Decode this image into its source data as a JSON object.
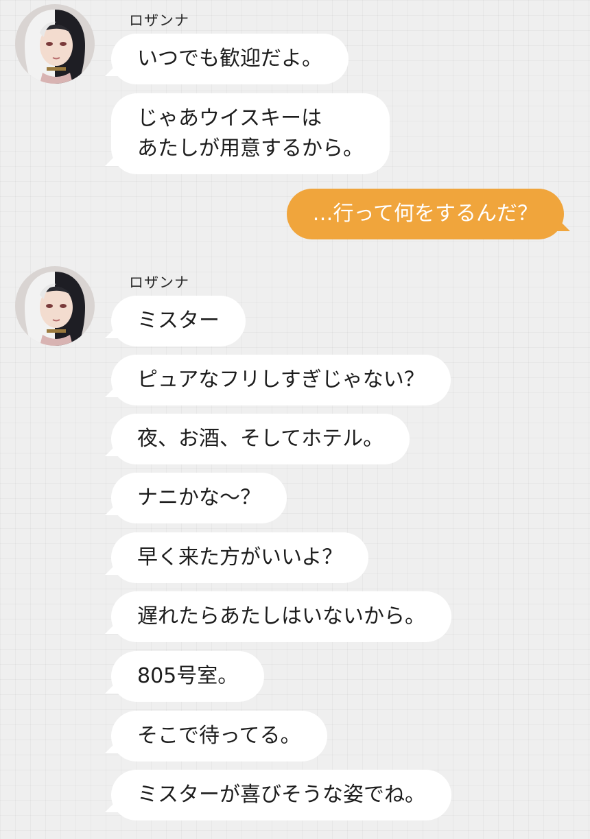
{
  "groups": [
    {
      "sender": "ロザンナ",
      "messages": [
        "いつでも歓迎だよ。",
        "じゃあウイスキーは\nあたしが用意するから。"
      ]
    },
    {
      "sender": "me",
      "messages": [
        "…行って何をするんだ？"
      ]
    },
    {
      "sender": "ロザンナ",
      "messages": [
        "ミスター",
        "ピュアなフリしすぎじゃない？",
        "夜、お酒、そしてホテル。",
        "ナニかな～？",
        "早く来た方がいいよ？",
        "遅れたらあたしはいないから。",
        "805号室。",
        "そこで待ってる。",
        "ミスターが喜びそうな姿でね。"
      ]
    }
  ],
  "colors": {
    "background": "#efefef",
    "incoming_bubble": "#ffffff",
    "outgoing_bubble": "#f0a53c",
    "outgoing_text": "#ffffff"
  },
  "icons": {
    "avatar": "rosanna-portrait"
  }
}
